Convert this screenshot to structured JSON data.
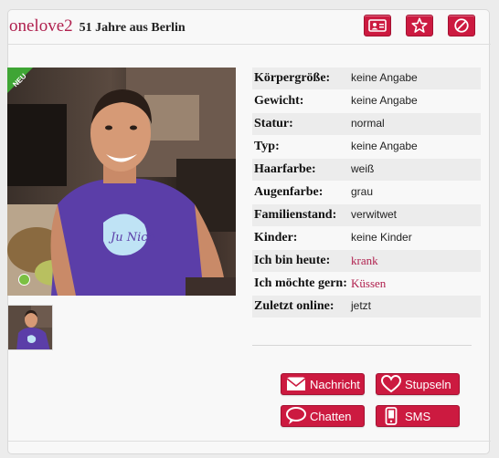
{
  "header": {
    "username": "onelove2",
    "age_location": "51 Jahre aus Berlin",
    "icons": [
      "profile-card-icon",
      "star-icon",
      "block-icon"
    ]
  },
  "photo": {
    "badge": "NEU",
    "online_dot_color": "#7bc043",
    "shirt_print": "Ju Nich"
  },
  "profile": [
    {
      "label": "Körpergröße:",
      "value": "keine Angabe",
      "highlight": false
    },
    {
      "label": "Gewicht:",
      "value": "keine Angabe",
      "highlight": false
    },
    {
      "label": "Statur:",
      "value": "normal",
      "highlight": false
    },
    {
      "label": "Typ:",
      "value": "keine Angabe",
      "highlight": false
    },
    {
      "label": "Haarfarbe:",
      "value": "weiß",
      "highlight": false
    },
    {
      "label": "Augenfarbe:",
      "value": "grau",
      "highlight": false
    },
    {
      "label": "Familienstand:",
      "value": "verwitwet",
      "highlight": false
    },
    {
      "label": "Kinder:",
      "value": "keine Kinder",
      "highlight": false
    },
    {
      "label": "Ich bin heute:",
      "value": "krank",
      "highlight": true
    },
    {
      "label": "Ich möchte gern:",
      "value": "Küssen",
      "highlight": true
    },
    {
      "label": "Zuletzt online:",
      "value": "jetzt",
      "highlight": false
    }
  ],
  "actions": {
    "message": "Nachricht",
    "stupseln": "Stupseln",
    "chat": "Chatten",
    "sms": "SMS"
  },
  "colors": {
    "accent": "#cc1a40",
    "username": "#b0204e",
    "badge": "#3fa535"
  }
}
